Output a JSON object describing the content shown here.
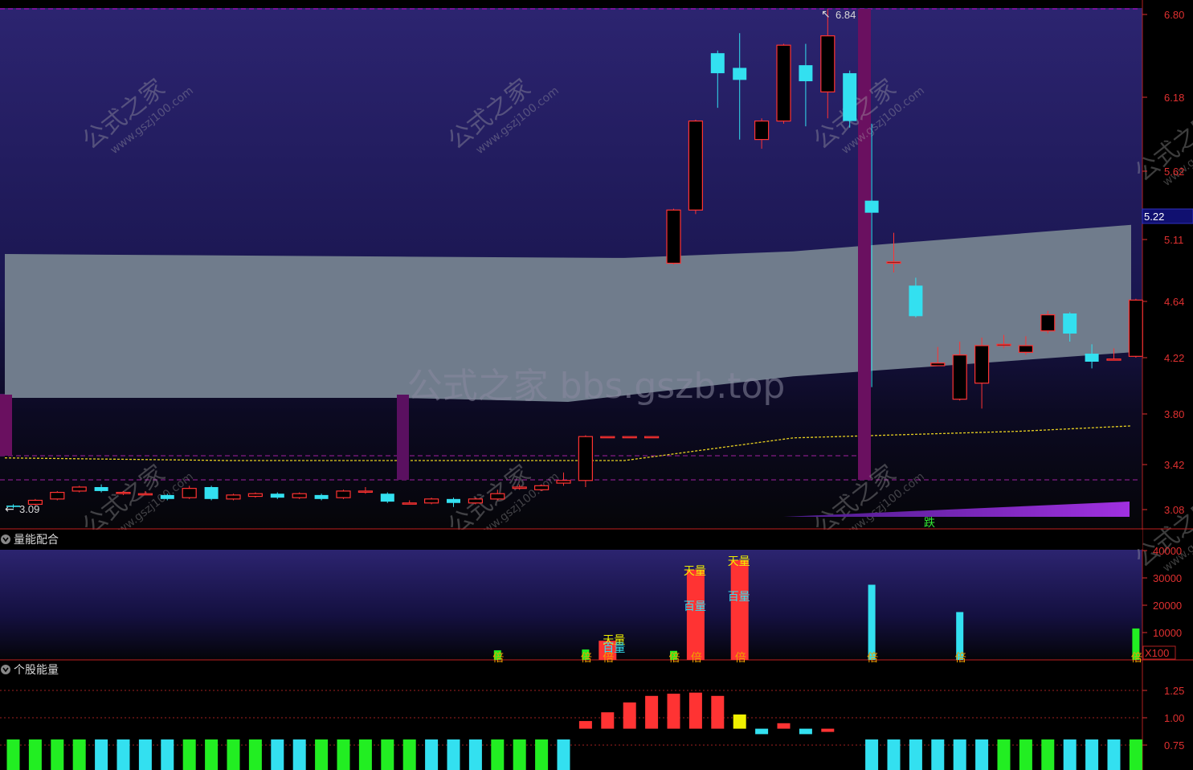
{
  "colors": {
    "up": "#ff3333",
    "down": "#33e0f0",
    "axis": "#e03030",
    "band": "#707c8c",
    "green": "#22ee22",
    "yellow": "#f0f000",
    "purple": "#9030d0",
    "magenta": "#e000e0"
  },
  "main": {
    "price_ticks": [
      "6.80",
      "6.18",
      "5.62",
      "5.11",
      "4.64",
      "4.22",
      "3.80",
      "3.42",
      "3.08"
    ],
    "current_price": "5.22",
    "high_marker": "6.84",
    "low_marker": "3.09",
    "watermark_center": "公式之家 bbs.gszb.top",
    "watermark_tile_cn": "公式之家",
    "watermark_tile_url": "www.gszj100.com",
    "drop_label": "跌"
  },
  "vol_panel": {
    "title": "量能配合",
    "ticks": [
      "40000",
      "30000",
      "20000",
      "10000"
    ],
    "unit": "X100",
    "labels": {
      "tian": "天量",
      "bai": "百量",
      "bei": "倍"
    }
  },
  "energy_panel": {
    "title": "个股能量",
    "ticks": [
      "1.25",
      "1.00",
      "0.75"
    ]
  },
  "chart_data": [
    {
      "type": "candlestick",
      "name": "main",
      "ylim": [
        3.0,
        6.9
      ],
      "y_ticks": [
        6.8,
        6.18,
        5.62,
        5.11,
        4.64,
        4.22,
        3.8,
        3.42,
        3.08
      ],
      "candles": [
        {
          "o": 3.11,
          "c": 3.1,
          "h": 3.12,
          "l": 3.09
        },
        {
          "o": 3.12,
          "c": 3.15,
          "h": 3.16,
          "l": 3.11
        },
        {
          "o": 3.16,
          "c": 3.21,
          "h": 3.22,
          "l": 3.15
        },
        {
          "o": 3.22,
          "c": 3.25,
          "h": 3.26,
          "l": 3.21
        },
        {
          "o": 3.25,
          "c": 3.22,
          "h": 3.27,
          "l": 3.21
        },
        {
          "o": 3.21,
          "c": 3.21,
          "h": 3.22,
          "l": 3.19
        },
        {
          "o": 3.2,
          "c": 3.2,
          "h": 3.22,
          "l": 3.19
        },
        {
          "o": 3.19,
          "c": 3.16,
          "h": 3.2,
          "l": 3.15
        },
        {
          "o": 3.17,
          "c": 3.24,
          "h": 3.26,
          "l": 3.16
        },
        {
          "o": 3.25,
          "c": 3.16,
          "h": 3.26,
          "l": 3.15
        },
        {
          "o": 3.16,
          "c": 3.19,
          "h": 3.2,
          "l": 3.15
        },
        {
          "o": 3.18,
          "c": 3.2,
          "h": 3.21,
          "l": 3.17
        },
        {
          "o": 3.2,
          "c": 3.17,
          "h": 3.21,
          "l": 3.16
        },
        {
          "o": 3.17,
          "c": 3.2,
          "h": 3.21,
          "l": 3.16
        },
        {
          "o": 3.19,
          "c": 3.16,
          "h": 3.2,
          "l": 3.15
        },
        {
          "o": 3.17,
          "c": 3.22,
          "h": 3.23,
          "l": 3.16
        },
        {
          "o": 3.22,
          "c": 3.22,
          "h": 3.25,
          "l": 3.2
        },
        {
          "o": 3.2,
          "c": 3.14,
          "h": 3.21,
          "l": 3.13
        },
        {
          "o": 3.13,
          "c": 3.13,
          "h": 3.15,
          "l": 3.12
        },
        {
          "o": 3.13,
          "c": 3.16,
          "h": 3.17,
          "l": 3.12
        },
        {
          "o": 3.16,
          "c": 3.13,
          "h": 3.17,
          "l": 3.1
        },
        {
          "o": 3.13,
          "c": 3.16,
          "h": 3.17,
          "l": 3.12
        },
        {
          "o": 3.16,
          "c": 3.2,
          "h": 3.23,
          "l": 3.15
        },
        {
          "o": 3.24,
          "c": 3.25,
          "h": 3.27,
          "l": 3.23
        },
        {
          "o": 3.23,
          "c": 3.26,
          "h": 3.27,
          "l": 3.22
        },
        {
          "o": 3.28,
          "c": 3.3,
          "h": 3.36,
          "l": 3.26
        },
        {
          "o": 3.3,
          "c": 3.63,
          "h": 3.64,
          "l": 3.25
        },
        {
          "o": 3.63,
          "c": 3.63,
          "h": 3.63,
          "l": 3.63
        },
        {
          "o": 3.63,
          "c": 3.63,
          "h": 3.63,
          "l": 3.63
        },
        {
          "o": 3.63,
          "c": 3.63,
          "h": 3.63,
          "l": 3.63
        },
        {
          "o": 4.93,
          "c": 5.33,
          "h": 5.34,
          "l": 4.92
        },
        {
          "o": 5.33,
          "c": 6.0,
          "h": 6.01,
          "l": 5.3
        },
        {
          "o": 6.51,
          "c": 6.36,
          "h": 6.53,
          "l": 6.1
        },
        {
          "o": 6.4,
          "c": 6.31,
          "h": 6.66,
          "l": 5.86
        },
        {
          "o": 5.86,
          "c": 6.0,
          "h": 6.02,
          "l": 5.79
        },
        {
          "o": 6.0,
          "c": 6.57,
          "h": 6.58,
          "l": 5.98
        },
        {
          "o": 6.42,
          "c": 6.3,
          "h": 6.58,
          "l": 5.96
        },
        {
          "o": 6.22,
          "c": 6.64,
          "h": 6.84,
          "l": 6.02
        },
        {
          "o": 6.36,
          "c": 6.0,
          "h": 6.38,
          "l": 5.95
        },
        {
          "o": 5.4,
          "c": 5.31,
          "h": 5.98,
          "l": 4.0
        },
        {
          "o": 4.93,
          "c": 4.94,
          "h": 5.16,
          "l": 4.86
        },
        {
          "o": 4.76,
          "c": 4.53,
          "h": 4.82,
          "l": 4.52
        },
        {
          "o": 4.16,
          "c": 4.18,
          "h": 4.3,
          "l": 4.16
        },
        {
          "o": 3.91,
          "c": 4.24,
          "h": 4.34,
          "l": 3.9
        },
        {
          "o": 4.03,
          "c": 4.31,
          "h": 4.37,
          "l": 3.84
        },
        {
          "o": 4.31,
          "c": 4.32,
          "h": 4.39,
          "l": 4.29
        },
        {
          "o": 4.26,
          "c": 4.31,
          "h": 4.38,
          "l": 4.24
        },
        {
          "o": 4.42,
          "c": 4.54,
          "h": 4.57,
          "l": 4.4
        },
        {
          "o": 4.55,
          "c": 4.4,
          "h": 4.56,
          "l": 4.34
        },
        {
          "o": 4.25,
          "c": 4.19,
          "h": 4.32,
          "l": 4.14
        },
        {
          "o": 4.21,
          "c": 4.21,
          "h": 4.29,
          "l": 4.2
        },
        {
          "o": 4.23,
          "c": 4.65,
          "h": 4.66,
          "l": 4.22
        }
      ],
      "band_upper": {
        "x": [
          0,
          0.35,
          0.55,
          0.7,
          1.0
        ],
        "y": [
          5.0,
          4.98,
          4.97,
          5.02,
          5.22
        ]
      },
      "band_lower": {
        "x": [
          0,
          0.35,
          0.5,
          0.7,
          1.0
        ],
        "y": [
          3.92,
          3.92,
          3.89,
          4.08,
          4.26
        ]
      },
      "ma_yellow": {
        "x": [
          0,
          0.2,
          0.55,
          0.7,
          0.9,
          1.0
        ],
        "y": [
          3.47,
          3.45,
          3.45,
          3.62,
          3.67,
          3.71
        ]
      }
    },
    {
      "type": "bar",
      "name": "volume",
      "unit": "X100",
      "ylim": [
        0,
        40000
      ],
      "bars": [
        {
          "i": 22,
          "v": 3500,
          "color": "green"
        },
        {
          "i": 26,
          "v": 3800,
          "color": "green"
        },
        {
          "i": 27,
          "v": 7000,
          "color": "red"
        },
        {
          "i": 30,
          "v": 3300,
          "color": "green"
        },
        {
          "i": 31,
          "v": 33000,
          "color": "red"
        },
        {
          "i": 33,
          "v": 36500,
          "color": "red"
        },
        {
          "i": 39,
          "v": 27500,
          "color": "cyan"
        },
        {
          "i": 43,
          "v": 17500,
          "color": "cyan"
        },
        {
          "i": 51,
          "v": 11500,
          "color": "green"
        }
      ]
    },
    {
      "type": "bar",
      "name": "energy",
      "ylim": [
        0.6,
        1.4
      ],
      "values": [
        0.8,
        0.8,
        0.8,
        0.8,
        0.8,
        0.8,
        0.8,
        0.8,
        0.8,
        0.8,
        0.8,
        0.8,
        0.8,
        0.8,
        0.8,
        0.8,
        0.8,
        0.8,
        0.8,
        0.8,
        0.8,
        0.8,
        0.8,
        0.8,
        0.8,
        0.8,
        0.97,
        1.05,
        1.14,
        1.2,
        1.22,
        1.23,
        1.2,
        1.03,
        0.85,
        0.95,
        0.85,
        0.9,
        0.7,
        0.8,
        0.8,
        0.8,
        0.8,
        0.8,
        0.8,
        0.8,
        0.8,
        0.8,
        0.8,
        0.8,
        0.8,
        0.8
      ],
      "colors": [
        "green",
        "green",
        "green",
        "green",
        "cyan",
        "cyan",
        "cyan",
        "cyan",
        "green",
        "green",
        "green",
        "green",
        "cyan",
        "cyan",
        "green",
        "green",
        "green",
        "green",
        "green",
        "cyan",
        "cyan",
        "cyan",
        "green",
        "green",
        "green",
        "cyan",
        "red",
        "red",
        "red",
        "red",
        "red",
        "red",
        "red",
        "yellow",
        "cyan",
        "red",
        "cyan",
        "red",
        "none",
        "cyan",
        "cyan",
        "cyan",
        "cyan",
        "cyan",
        "cyan",
        "green",
        "green",
        "green",
        "cyan",
        "cyan",
        "cyan",
        "green"
      ]
    }
  ]
}
